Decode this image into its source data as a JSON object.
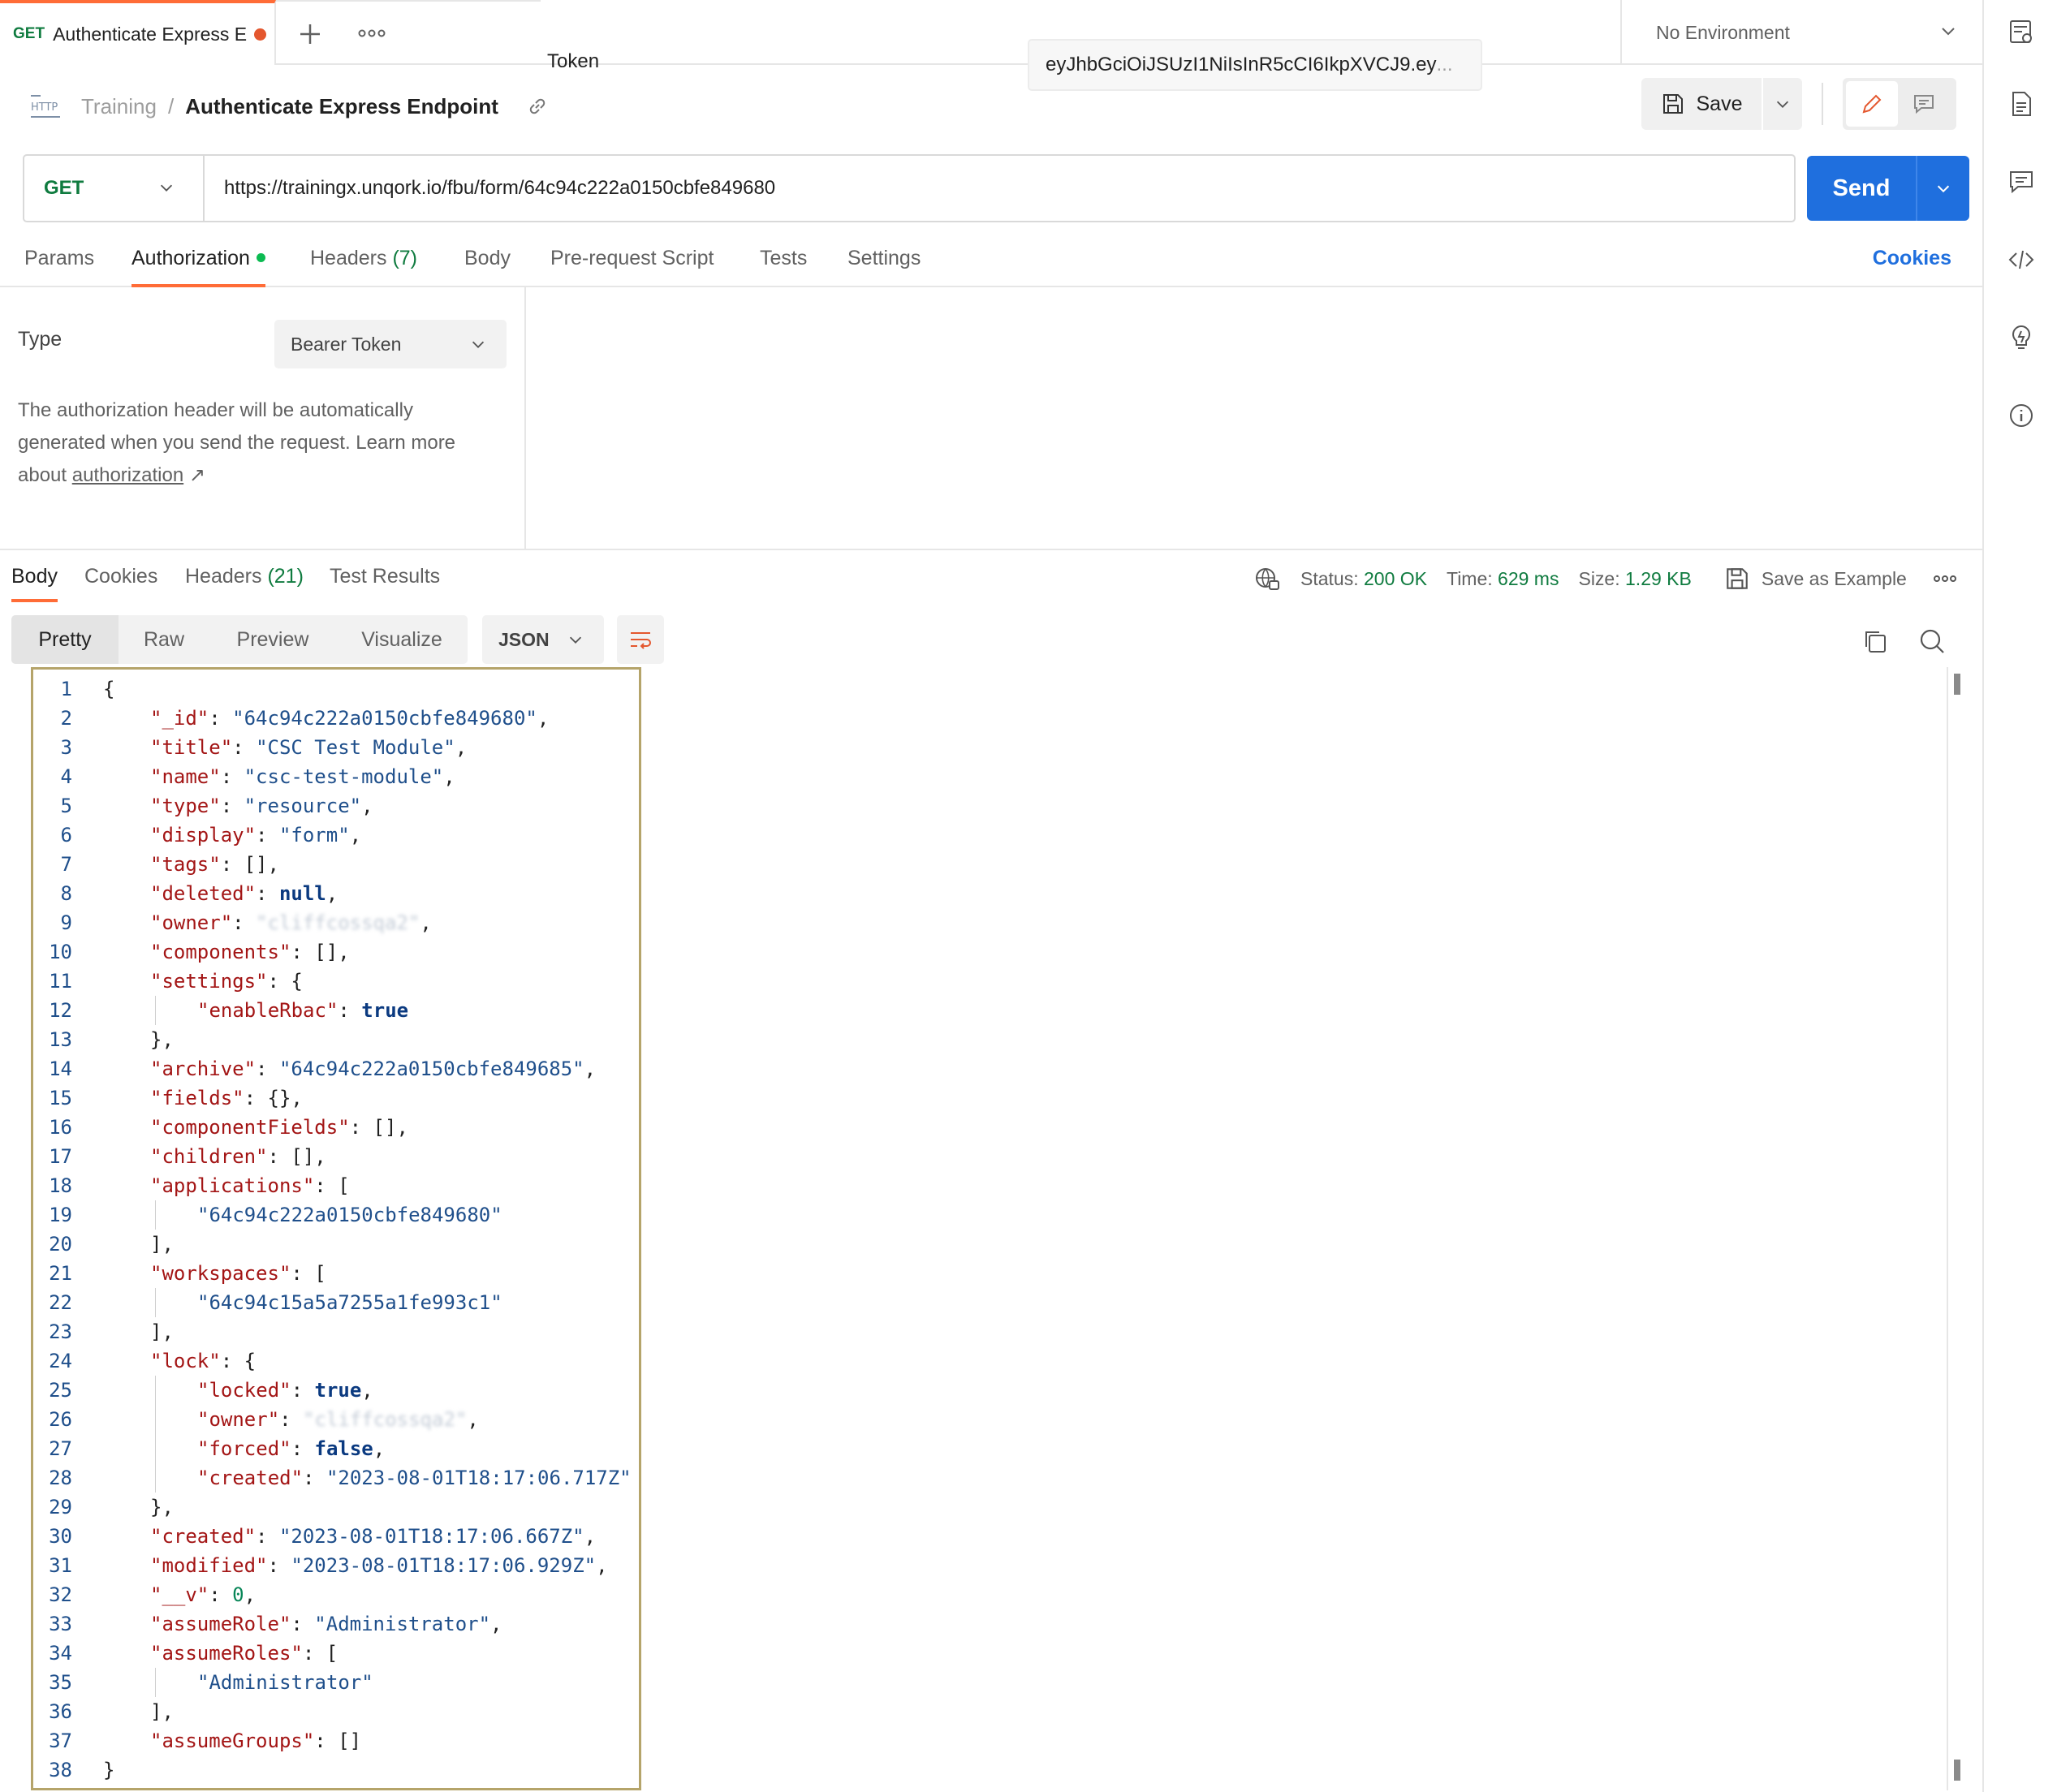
{
  "tab": {
    "method": "GET",
    "name": "Authenticate Express E"
  },
  "environment": {
    "label": "No Environment"
  },
  "breadcrumb": {
    "collection": "Training",
    "separator": "/",
    "request": "Authenticate Express Endpoint"
  },
  "toolbar": {
    "save_label": "Save"
  },
  "url_bar": {
    "method": "GET",
    "url": "https://trainingx.unqork.io/fbu/form/64c94c222a0150cbfe849680",
    "send_label": "Send"
  },
  "request_tabs": [
    {
      "label": "Params",
      "count": ""
    },
    {
      "label": "Authorization",
      "count": ""
    },
    {
      "label": "Headers",
      "count": "(7)"
    },
    {
      "label": "Body",
      "count": ""
    },
    {
      "label": "Pre-request Script",
      "count": ""
    },
    {
      "label": "Tests",
      "count": ""
    },
    {
      "label": "Settings",
      "count": ""
    }
  ],
  "cookies_link": "Cookies",
  "auth": {
    "type_label": "Type",
    "type_value": "Bearer Token",
    "desc_text": "The authorization header will be automatically generated when you send the request. Learn more about ",
    "desc_link": "authorization",
    "desc_arrow": "↗",
    "token_label": "Token",
    "token_value": "eyJhbGciOiJSUzI1NiIsInR5cCI6IkpXVCJ9.ey",
    "token_ellipsis": "..."
  },
  "response_tabs": [
    {
      "label": "Body",
      "count": ""
    },
    {
      "label": "Cookies",
      "count": ""
    },
    {
      "label": "Headers",
      "count": "(21)"
    },
    {
      "label": "Test Results",
      "count": ""
    }
  ],
  "response_meta": {
    "status_label": "Status:",
    "status_value": "200 OK",
    "time_label": "Time:",
    "time_value": "629 ms",
    "size_label": "Size:",
    "size_value": "1.29 KB",
    "save_example": "Save as Example"
  },
  "format_tabs": [
    "Pretty",
    "Raw",
    "Preview",
    "Visualize"
  ],
  "language": "JSON",
  "code_lines": [
    {
      "n": "1",
      "indent": 0,
      "parts": [
        [
          "p",
          "{"
        ]
      ]
    },
    {
      "n": "2",
      "indent": 1,
      "parts": [
        [
          "k",
          "\"_id\""
        ],
        [
          "p",
          ": "
        ],
        [
          "s",
          "\"64c94c222a0150cbfe849680\""
        ],
        [
          "p",
          ","
        ]
      ]
    },
    {
      "n": "3",
      "indent": 1,
      "parts": [
        [
          "k",
          "\"title\""
        ],
        [
          "p",
          ": "
        ],
        [
          "s",
          "\"CSC Test Module\""
        ],
        [
          "p",
          ","
        ]
      ]
    },
    {
      "n": "4",
      "indent": 1,
      "parts": [
        [
          "k",
          "\"name\""
        ],
        [
          "p",
          ": "
        ],
        [
          "s",
          "\"csc-test-module\""
        ],
        [
          "p",
          ","
        ]
      ]
    },
    {
      "n": "5",
      "indent": 1,
      "parts": [
        [
          "k",
          "\"type\""
        ],
        [
          "p",
          ": "
        ],
        [
          "s",
          "\"resource\""
        ],
        [
          "p",
          ","
        ]
      ]
    },
    {
      "n": "6",
      "indent": 1,
      "parts": [
        [
          "k",
          "\"display\""
        ],
        [
          "p",
          ": "
        ],
        [
          "s",
          "\"form\""
        ],
        [
          "p",
          ","
        ]
      ]
    },
    {
      "n": "7",
      "indent": 1,
      "parts": [
        [
          "k",
          "\"tags\""
        ],
        [
          "p",
          ": [],"
        ]
      ]
    },
    {
      "n": "8",
      "indent": 1,
      "parts": [
        [
          "k",
          "\"deleted\""
        ],
        [
          "p",
          ": "
        ],
        [
          "b",
          "null"
        ],
        [
          "p",
          ","
        ]
      ]
    },
    {
      "n": "9",
      "indent": 1,
      "parts": [
        [
          "k",
          "\"owner\""
        ],
        [
          "p",
          ": "
        ],
        [
          "x",
          "\"cliffcossqa2\""
        ],
        [
          "p",
          ","
        ]
      ]
    },
    {
      "n": "10",
      "indent": 1,
      "parts": [
        [
          "k",
          "\"components\""
        ],
        [
          "p",
          ": [],"
        ]
      ]
    },
    {
      "n": "11",
      "indent": 1,
      "parts": [
        [
          "k",
          "\"settings\""
        ],
        [
          "p",
          ": {"
        ]
      ]
    },
    {
      "n": "12",
      "indent": 2,
      "parts": [
        [
          "k",
          "\"enableRbac\""
        ],
        [
          "p",
          ": "
        ],
        [
          "b",
          "true"
        ]
      ]
    },
    {
      "n": "13",
      "indent": 1,
      "parts": [
        [
          "p",
          "},"
        ]
      ]
    },
    {
      "n": "14",
      "indent": 1,
      "parts": [
        [
          "k",
          "\"archive\""
        ],
        [
          "p",
          ": "
        ],
        [
          "s",
          "\"64c94c222a0150cbfe849685\""
        ],
        [
          "p",
          ","
        ]
      ]
    },
    {
      "n": "15",
      "indent": 1,
      "parts": [
        [
          "k",
          "\"fields\""
        ],
        [
          "p",
          ": {},"
        ]
      ]
    },
    {
      "n": "16",
      "indent": 1,
      "parts": [
        [
          "k",
          "\"componentFields\""
        ],
        [
          "p",
          ": [],"
        ]
      ]
    },
    {
      "n": "17",
      "indent": 1,
      "parts": [
        [
          "k",
          "\"children\""
        ],
        [
          "p",
          ": [],"
        ]
      ]
    },
    {
      "n": "18",
      "indent": 1,
      "parts": [
        [
          "k",
          "\"applications\""
        ],
        [
          "p",
          ": ["
        ]
      ]
    },
    {
      "n": "19",
      "indent": 2,
      "parts": [
        [
          "s",
          "\"64c94c222a0150cbfe849680\""
        ]
      ]
    },
    {
      "n": "20",
      "indent": 1,
      "parts": [
        [
          "p",
          "],"
        ]
      ]
    },
    {
      "n": "21",
      "indent": 1,
      "parts": [
        [
          "k",
          "\"workspaces\""
        ],
        [
          "p",
          ": ["
        ]
      ]
    },
    {
      "n": "22",
      "indent": 2,
      "parts": [
        [
          "s",
          "\"64c94c15a5a7255a1fe993c1\""
        ]
      ]
    },
    {
      "n": "23",
      "indent": 1,
      "parts": [
        [
          "p",
          "],"
        ]
      ]
    },
    {
      "n": "24",
      "indent": 1,
      "parts": [
        [
          "k",
          "\"lock\""
        ],
        [
          "p",
          ": {"
        ]
      ]
    },
    {
      "n": "25",
      "indent": 2,
      "parts": [
        [
          "k",
          "\"locked\""
        ],
        [
          "p",
          ": "
        ],
        [
          "b",
          "true"
        ],
        [
          "p",
          ","
        ]
      ]
    },
    {
      "n": "26",
      "indent": 2,
      "parts": [
        [
          "k",
          "\"owner\""
        ],
        [
          "p",
          ": "
        ],
        [
          "x",
          "\"cliffcossqa2\""
        ],
        [
          "p",
          ","
        ]
      ]
    },
    {
      "n": "27",
      "indent": 2,
      "parts": [
        [
          "k",
          "\"forced\""
        ],
        [
          "p",
          ": "
        ],
        [
          "b",
          "false"
        ],
        [
          "p",
          ","
        ]
      ]
    },
    {
      "n": "28",
      "indent": 2,
      "parts": [
        [
          "k",
          "\"created\""
        ],
        [
          "p",
          ": "
        ],
        [
          "s",
          "\"2023-08-01T18:17:06.717Z\""
        ]
      ]
    },
    {
      "n": "29",
      "indent": 1,
      "parts": [
        [
          "p",
          "},"
        ]
      ]
    },
    {
      "n": "30",
      "indent": 1,
      "parts": [
        [
          "k",
          "\"created\""
        ],
        [
          "p",
          ": "
        ],
        [
          "s",
          "\"2023-08-01T18:17:06.667Z\""
        ],
        [
          "p",
          ","
        ]
      ]
    },
    {
      "n": "31",
      "indent": 1,
      "parts": [
        [
          "k",
          "\"modified\""
        ],
        [
          "p",
          ": "
        ],
        [
          "s",
          "\"2023-08-01T18:17:06.929Z\""
        ],
        [
          "p",
          ","
        ]
      ]
    },
    {
      "n": "32",
      "indent": 1,
      "parts": [
        [
          "k",
          "\"__v\""
        ],
        [
          "p",
          ": "
        ],
        [
          "n",
          "0"
        ],
        [
          "p",
          ","
        ]
      ]
    },
    {
      "n": "33",
      "indent": 1,
      "parts": [
        [
          "k",
          "\"assumeRole\""
        ],
        [
          "p",
          ": "
        ],
        [
          "s",
          "\"Administrator\""
        ],
        [
          "p",
          ","
        ]
      ]
    },
    {
      "n": "34",
      "indent": 1,
      "parts": [
        [
          "k",
          "\"assumeRoles\""
        ],
        [
          "p",
          ": ["
        ]
      ]
    },
    {
      "n": "35",
      "indent": 2,
      "parts": [
        [
          "s",
          "\"Administrator\""
        ]
      ]
    },
    {
      "n": "36",
      "indent": 1,
      "parts": [
        [
          "p",
          "],"
        ]
      ]
    },
    {
      "n": "37",
      "indent": 1,
      "parts": [
        [
          "k",
          "\"assumeGroups\""
        ],
        [
          "p",
          ": []"
        ]
      ]
    },
    {
      "n": "38",
      "indent": 0,
      "parts": [
        [
          "p",
          "}"
        ]
      ]
    }
  ],
  "colors": {
    "accent": "#ff6c37",
    "send": "#1f6fde",
    "get": "#0f7b3f",
    "status_ok": "#0f7b3f"
  }
}
